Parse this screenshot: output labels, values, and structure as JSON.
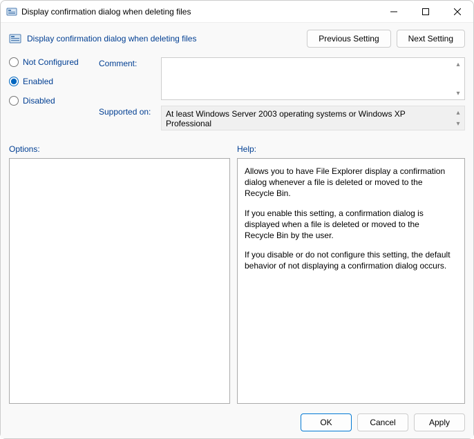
{
  "window": {
    "title": "Display confirmation dialog when deleting files"
  },
  "header": {
    "policy_title": "Display confirmation dialog when deleting files",
    "previous_label": "Previous Setting",
    "next_label": "Next Setting"
  },
  "state": {
    "options": [
      {
        "value": "not_configured",
        "label": "Not Configured"
      },
      {
        "value": "enabled",
        "label": "Enabled"
      },
      {
        "value": "disabled",
        "label": "Disabled"
      }
    ],
    "selected": "enabled"
  },
  "fields": {
    "comment_label": "Comment:",
    "comment_value": "",
    "supported_label": "Supported on:",
    "supported_value": "At least Windows Server 2003 operating systems or Windows XP Professional"
  },
  "panels": {
    "options_label": "Options:",
    "help_label": "Help:",
    "help_paragraphs": [
      "Allows you to have File Explorer display a confirmation dialog whenever a file is deleted or moved to the Recycle Bin.",
      "If you enable this setting, a confirmation dialog is displayed when a file is deleted or moved to the Recycle Bin by the user.",
      "If you disable or do not configure this setting, the default behavior of not displaying a confirmation dialog occurs."
    ]
  },
  "footer": {
    "ok_label": "OK",
    "cancel_label": "Cancel",
    "apply_label": "Apply"
  }
}
